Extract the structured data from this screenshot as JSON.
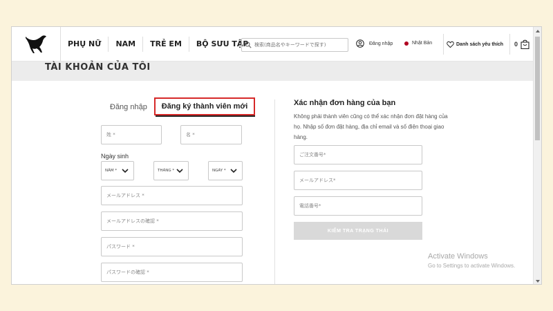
{
  "header": {
    "nav": [
      "PHỤ NỮ",
      "NAM",
      "TRẺ EM",
      "BỘ SƯU TẬP"
    ],
    "search_placeholder": "検索(商品名やキーワードで探す)",
    "login_label": "Đăng nhập",
    "region_label": "Nhật Bản",
    "wishlist_label": "Danh sách yêu thích",
    "cart_count": "0",
    "accent_color": "#b00020"
  },
  "page": {
    "title": "TÀI KHOẢN CỦA TÔI"
  },
  "tabs": {
    "login": "Đăng nhập",
    "register": "Đăng ký thành viên mới"
  },
  "register_form": {
    "last_name": "姓 *",
    "first_name": "名 *",
    "dob_label": "Ngày sinh",
    "year": "NĂM *",
    "month": "THÁNG *",
    "day": "NGÀY *",
    "email": "メールアドレス *",
    "email_confirm": "メールアドレスの確認 *",
    "password": "パスワード *",
    "password_confirm": "パスワードの確認 *"
  },
  "order_check": {
    "title": "Xác nhận đơn hàng của bạn",
    "description": "Không phải thành viên cũng có thể xác nhận đơn đặt hàng của họ. Nhập số đơn đặt hàng, địa chỉ email và số điện thoại giao hàng.",
    "order_number": "ご注文番号*",
    "email": "メールアドレス*",
    "phone": "電話番号*",
    "button": "KIỂM TRA TRẠNG THÁI"
  },
  "watermark": {
    "line1": "Activate Windows",
    "line2": "Go to Settings to activate Windows."
  }
}
